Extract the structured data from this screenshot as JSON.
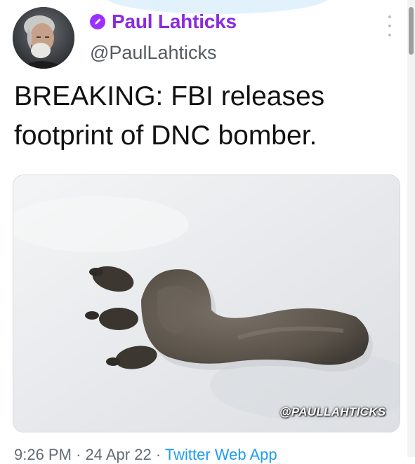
{
  "tweet": {
    "display_name": "Paul Lahticks",
    "handle": "@PaulLahticks",
    "text_line1": "BREAKING: FBI releases",
    "text_line2": "footprint of DNC bomber.",
    "media_watermark": "@PAULLAHTICKS",
    "time": "9:26 PM",
    "date": "24 Apr 22",
    "source_app": "Twitter Web App"
  },
  "icons": {
    "badge": "parody-badge-icon",
    "more": "more-vertical-icon"
  },
  "colors": {
    "display_name": "#8a2be2",
    "badge": "#9b30ff",
    "link": "#1d9bf0",
    "text": "#111111"
  }
}
